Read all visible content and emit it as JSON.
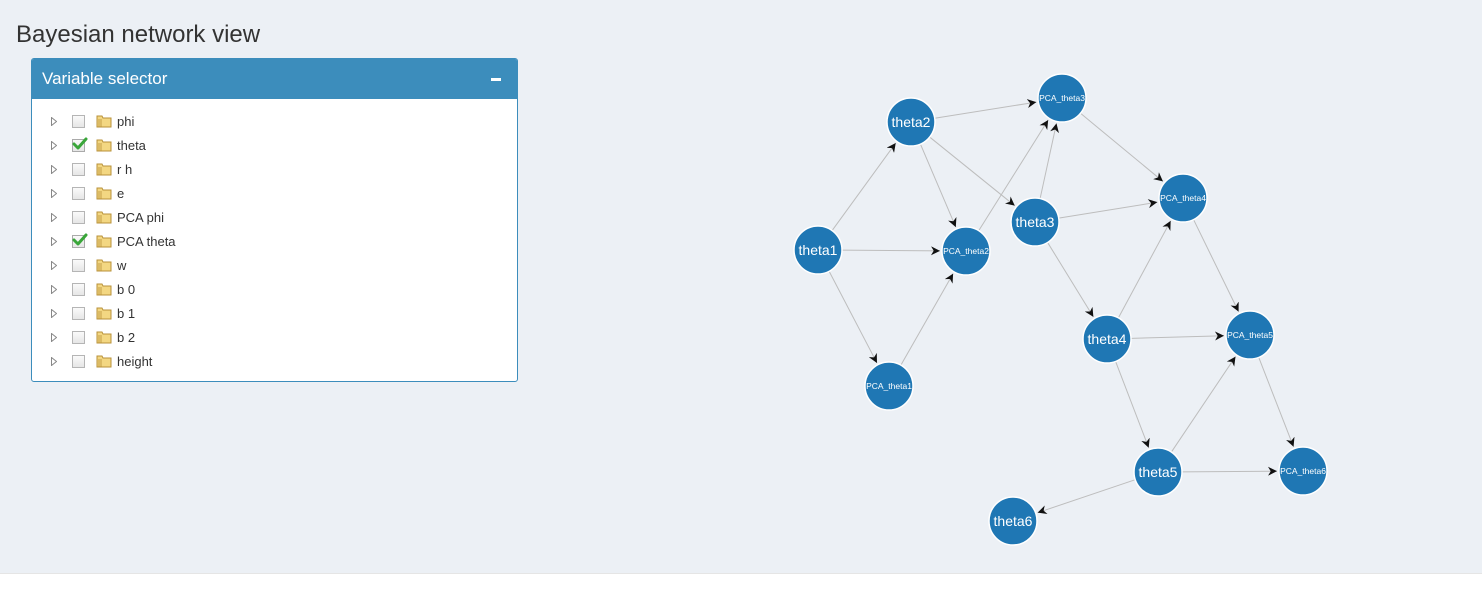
{
  "page": {
    "title": "Bayesian network view"
  },
  "selector": {
    "title": "Variable selector",
    "collapse_label": "−",
    "items": [
      {
        "label": "phi",
        "checked": false
      },
      {
        "label": "theta",
        "checked": true
      },
      {
        "label": "r h",
        "checked": false
      },
      {
        "label": "e",
        "checked": false
      },
      {
        "label": "PCA phi",
        "checked": false
      },
      {
        "label": "PCA theta",
        "checked": true
      },
      {
        "label": "w",
        "checked": false
      },
      {
        "label": "b 0",
        "checked": false
      },
      {
        "label": "b 1",
        "checked": false
      },
      {
        "label": "b 2",
        "checked": false
      },
      {
        "label": "height",
        "checked": false
      }
    ]
  },
  "network": {
    "node_color": "#1f77b4",
    "nodes": [
      {
        "id": "theta1",
        "label": "theta1"
      },
      {
        "id": "theta2",
        "label": "theta2"
      },
      {
        "id": "theta3",
        "label": "theta3"
      },
      {
        "id": "theta4",
        "label": "theta4"
      },
      {
        "id": "theta5",
        "label": "theta5"
      },
      {
        "id": "theta6",
        "label": "theta6"
      },
      {
        "id": "PCA_theta1",
        "label": "PCA_theta1"
      },
      {
        "id": "PCA_theta2",
        "label": "PCA_theta2"
      },
      {
        "id": "PCA_theta3",
        "label": "PCA_theta3"
      },
      {
        "id": "PCA_theta4",
        "label": "PCA_theta4"
      },
      {
        "id": "PCA_theta5",
        "label": "PCA_theta5"
      },
      {
        "id": "PCA_theta6",
        "label": "PCA_theta6"
      }
    ],
    "edges": [
      [
        "theta1",
        "theta2"
      ],
      [
        "theta1",
        "PCA_theta2"
      ],
      [
        "theta1",
        "PCA_theta1"
      ],
      [
        "theta2",
        "PCA_theta3"
      ],
      [
        "theta2",
        "PCA_theta2"
      ],
      [
        "theta2",
        "theta3"
      ],
      [
        "PCA_theta1",
        "PCA_theta2"
      ],
      [
        "PCA_theta2",
        "PCA_theta3"
      ],
      [
        "theta3",
        "PCA_theta3"
      ],
      [
        "theta3",
        "PCA_theta4"
      ],
      [
        "theta3",
        "theta4"
      ],
      [
        "PCA_theta3",
        "PCA_theta4"
      ],
      [
        "theta4",
        "PCA_theta4"
      ],
      [
        "theta4",
        "PCA_theta5"
      ],
      [
        "theta4",
        "theta5"
      ],
      [
        "PCA_theta4",
        "PCA_theta5"
      ],
      [
        "theta5",
        "PCA_theta5"
      ],
      [
        "theta5",
        "PCA_theta6"
      ],
      [
        "theta5",
        "theta6"
      ],
      [
        "PCA_theta5",
        "PCA_theta6"
      ]
    ]
  }
}
